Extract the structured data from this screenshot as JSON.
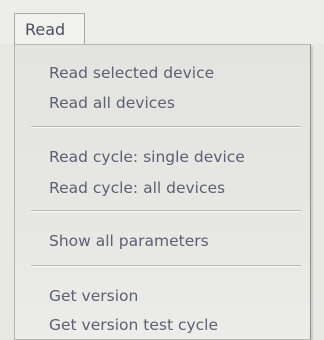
{
  "menu": {
    "title": "Read",
    "groups": [
      {
        "items": [
          {
            "label": "Read selected device"
          },
          {
            "label": "Read all devices"
          }
        ]
      },
      {
        "items": [
          {
            "label": "Read cycle: single device"
          },
          {
            "label": "Read cycle: all devices"
          }
        ]
      },
      {
        "items": [
          {
            "label": "Show all parameters"
          }
        ]
      },
      {
        "items": [
          {
            "label": "Get version"
          },
          {
            "label": "Get version test cycle"
          }
        ]
      }
    ]
  }
}
